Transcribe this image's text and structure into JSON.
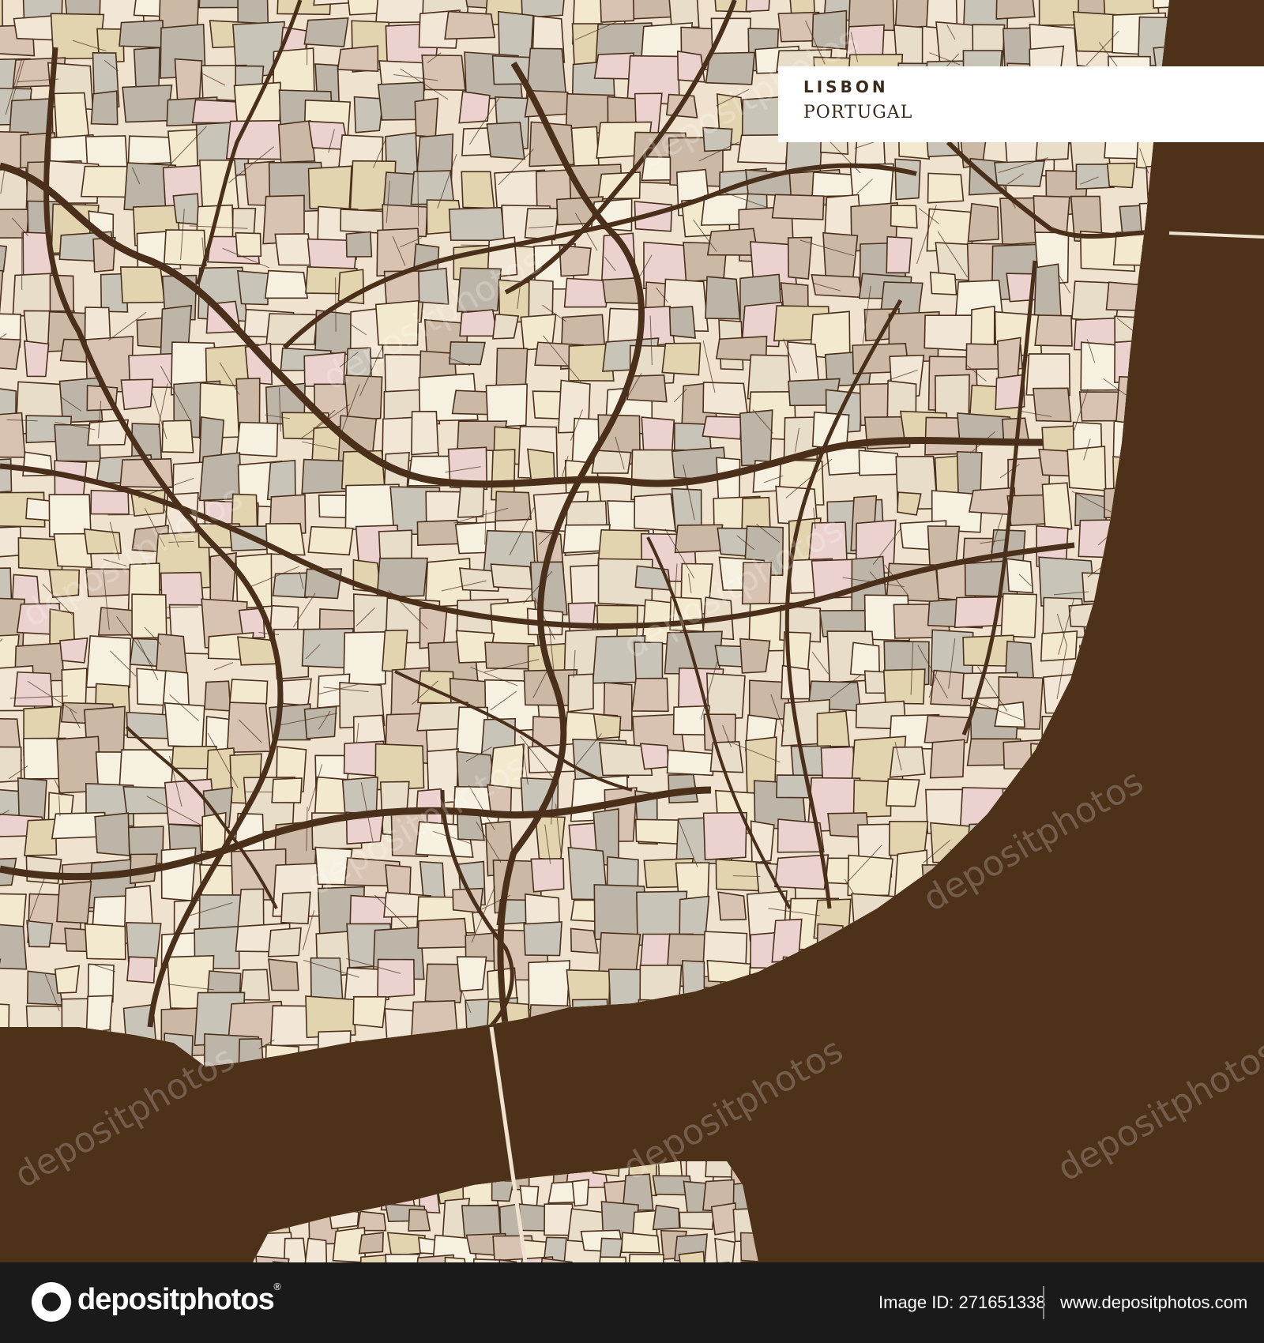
{
  "map": {
    "city": "LISBON",
    "country": "PORTUGAL",
    "water_color": "#4d3119",
    "road_color": "#4a2f1a",
    "block_colors": [
      "#c9c4b8",
      "#e8ddc8",
      "#f2e6d6",
      "#d8c2b2",
      "#ebd2cf",
      "#f6f0e0",
      "#bdb6a8",
      "#e3d4b0",
      "#f3e9cf",
      "#cbb9a6"
    ]
  },
  "watermark": {
    "text": "depositphotos"
  },
  "footer": {
    "logo_text": "depositphotos",
    "logo_mark": "®",
    "image_id_label": "Image ID: 271651338",
    "website": "www.depositphotos.com"
  }
}
